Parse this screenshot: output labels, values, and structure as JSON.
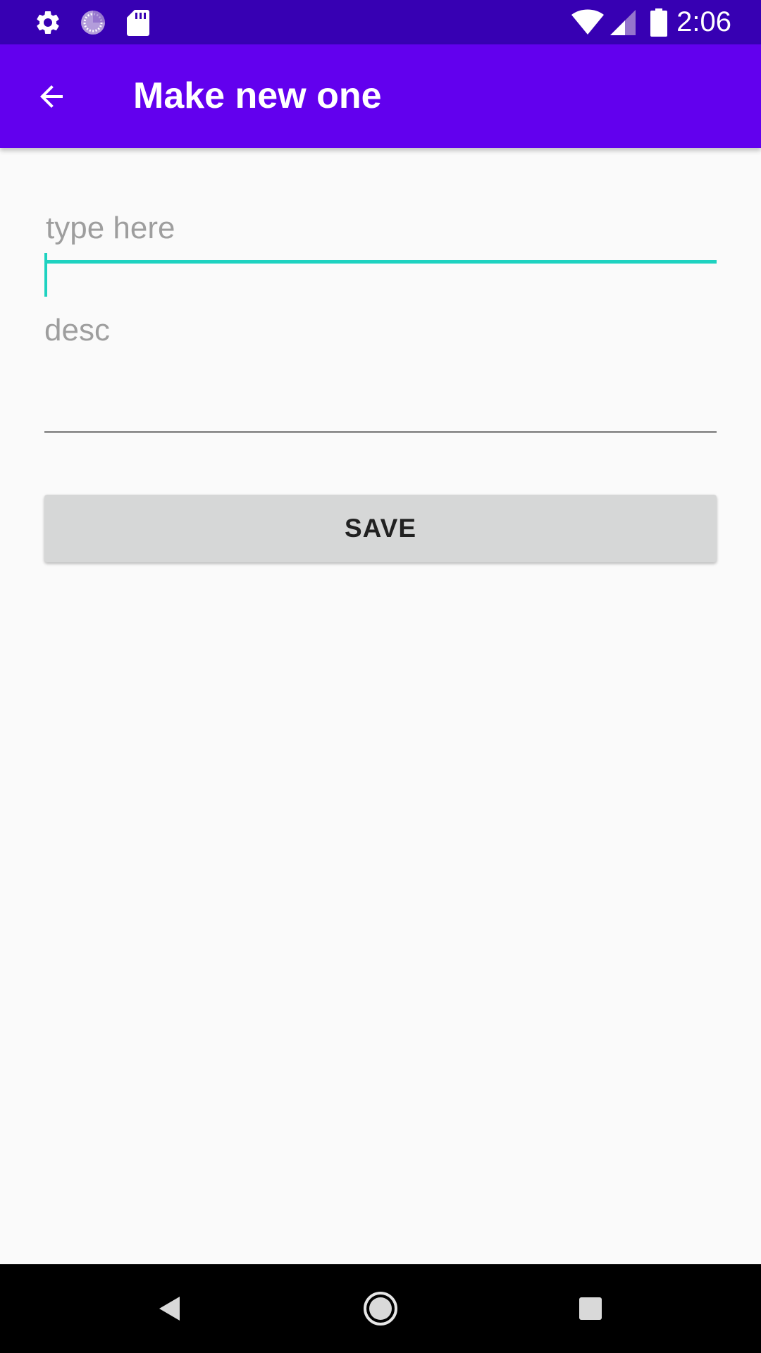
{
  "status_bar": {
    "time": "2:06",
    "left_icons": [
      "settings-icon",
      "sync-icon",
      "sd-card-icon"
    ],
    "right_icons": [
      "wifi-icon",
      "cell-signal-icon",
      "battery-icon"
    ]
  },
  "app_bar": {
    "title": "Make new one",
    "back_icon": "arrow-back-icon",
    "background": "#6200ee"
  },
  "form": {
    "title_field": {
      "value": "",
      "placeholder": "type here",
      "focused": true,
      "accent": "#1ed2c0"
    },
    "desc_field": {
      "value": "",
      "placeholder": "desc"
    },
    "save_label": "SAVE"
  },
  "nav_bar": {
    "buttons": [
      "back-icon",
      "home-icon",
      "recents-icon"
    ]
  },
  "colors": {
    "status_bar": "#3700b3",
    "primary": "#6200ee",
    "accent": "#1ed2c0",
    "background": "#fafafa",
    "button": "#d6d7d7"
  }
}
